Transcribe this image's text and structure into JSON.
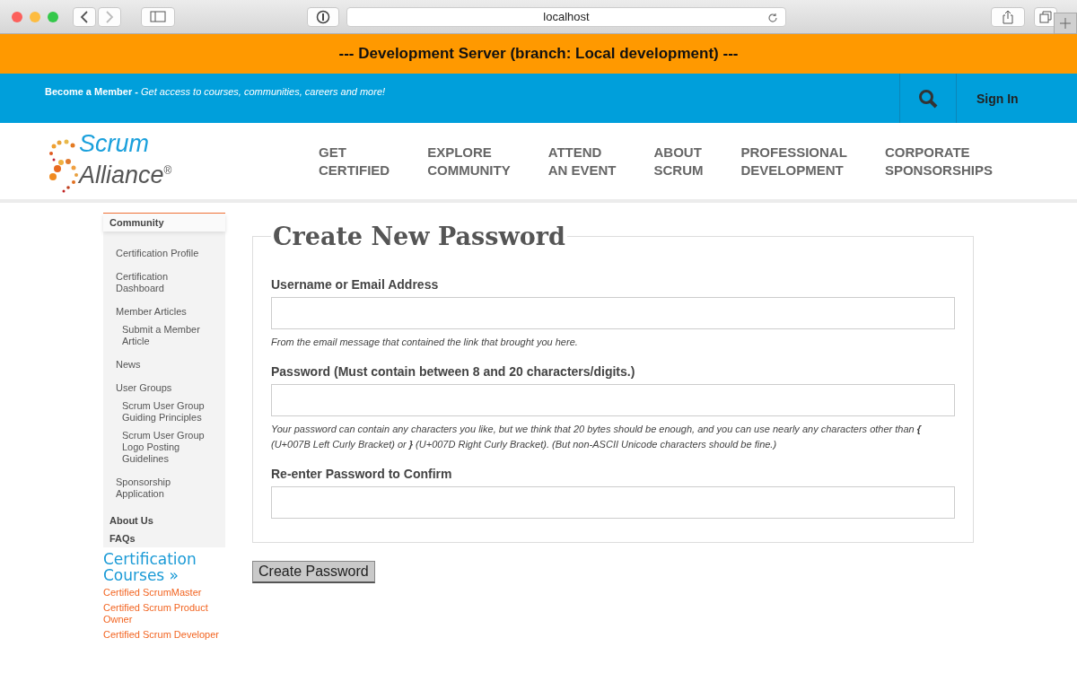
{
  "browser": {
    "url": "localhost"
  },
  "dev_banner": "--- Development Server (branch: Local development) ---",
  "top_bar": {
    "member_title": "Become a Member -",
    "member_text": "Get access to courses, communities, careers and more!",
    "sign_in": "Sign In"
  },
  "logo": {
    "line_1": "Scrum",
    "line_2": "Alliance",
    "mark": "®"
  },
  "nav": [
    {
      "line_1": "GET",
      "line_2": "CERTIFIED"
    },
    {
      "line_1": "EXPLORE",
      "line_2": "COMMUNITY"
    },
    {
      "line_1": "ATTEND",
      "line_2": "AN EVENT"
    },
    {
      "line_1": "ABOUT",
      "line_2": "SCRUM"
    },
    {
      "line_1": "PROFESSIONAL",
      "line_2": "DEVELOPMENT"
    },
    {
      "line_1": "CORPORATE",
      "line_2": "SPONSORSHIPS"
    }
  ],
  "sidebar": {
    "sections": [
      {
        "label": "Community",
        "expanded": true,
        "children": [
          {
            "label": "Certification Profile"
          },
          {
            "label": "Certification Dashboard"
          },
          {
            "label": "Member Articles",
            "children": [
              {
                "label": "Submit a Member Article"
              }
            ]
          },
          {
            "label": "News"
          },
          {
            "label": "User Groups",
            "children": [
              {
                "label": "Scrum User Group Guiding Principles"
              },
              {
                "label": "Scrum User Group Logo Posting Guidelines"
              }
            ]
          },
          {
            "label": "Sponsorship Application"
          }
        ]
      },
      {
        "label": "About Us",
        "expanded": false
      },
      {
        "label": "FAQs",
        "expanded": false
      }
    ],
    "courses_title": "Certification Courses »",
    "courses": [
      "Certified ScrumMaster",
      "Certified Scrum Product Owner",
      "Certified Scrum Developer"
    ]
  },
  "form": {
    "title": "Create New Password",
    "fields": [
      {
        "label": "Username or Email Address",
        "hint": "From the email message that contained the link that brought you here."
      },
      {
        "label": "Password (Must contain between 8 and 20 characters/digits.)",
        "hint": "Your password can contain any characters you like, but we think that 20 bytes should be enough, and you can use nearly any characters other than **{** (U+007B Left Curly Bracket) or **}** (U+007D Right Curly Bracket). (But non-ASCII Unicode characters should be fine.)"
      },
      {
        "label": "Re-enter Password to Confirm"
      }
    ],
    "submit": "Create Password"
  }
}
